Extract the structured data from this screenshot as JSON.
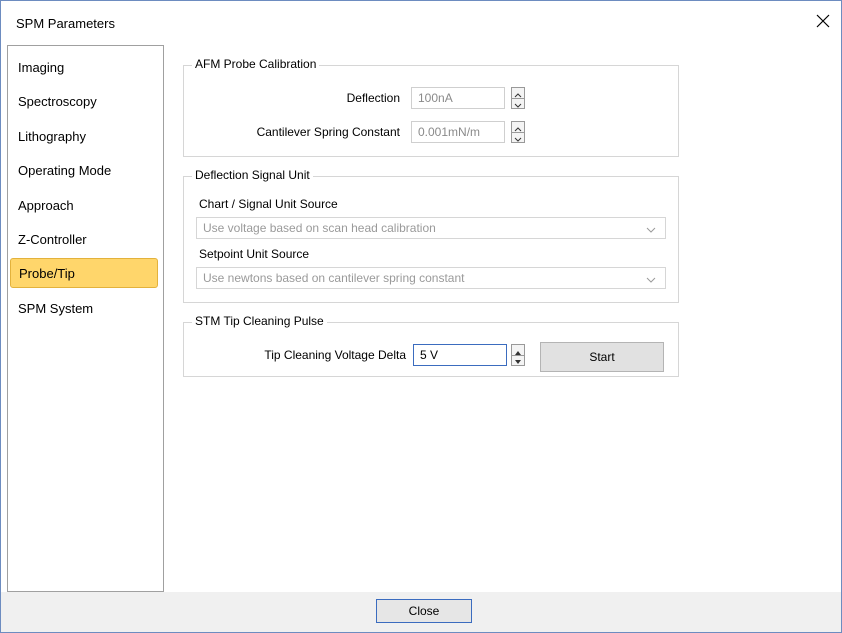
{
  "window": {
    "title": "SPM Parameters"
  },
  "sidebar": {
    "items": [
      {
        "label": "Imaging"
      },
      {
        "label": "Spectroscopy"
      },
      {
        "label": "Lithography"
      },
      {
        "label": "Operating Mode"
      },
      {
        "label": "Approach"
      },
      {
        "label": "Z-Controller"
      },
      {
        "label": "Probe/Tip",
        "selected": true
      },
      {
        "label": "SPM System"
      }
    ]
  },
  "afm_calibration": {
    "title": "AFM Probe Calibration",
    "deflection_label": "Deflection",
    "deflection_value": "100nA",
    "spring_label": "Cantilever Spring Constant",
    "spring_value": "0.001mN/m"
  },
  "deflection_signal": {
    "title": "Deflection Signal Unit",
    "chart_source_label": "Chart / Signal Unit Source",
    "chart_source_value": "Use voltage based on scan head calibration",
    "setpoint_source_label": "Setpoint Unit Source",
    "setpoint_source_value": "Use newtons based on cantilever spring constant"
  },
  "stm_cleaning": {
    "title": "STM Tip Cleaning Pulse",
    "voltage_label": "Tip Cleaning Voltage Delta",
    "voltage_value": "5 V",
    "start_label": "Start"
  },
  "footer": {
    "close_label": "Close"
  },
  "colors": {
    "selected_bg": "#ffd66b",
    "accent": "#3b6cbf"
  }
}
